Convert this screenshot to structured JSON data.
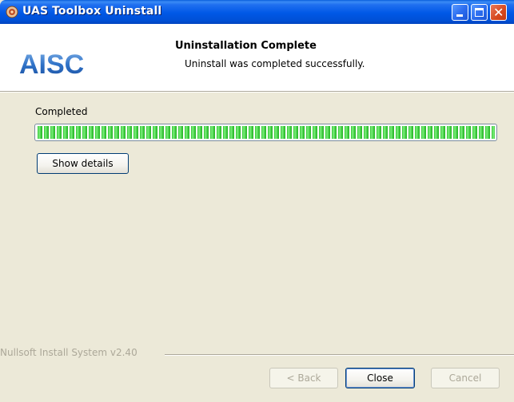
{
  "window": {
    "title": "UAS Toolbox Uninstall",
    "title_icon": "installer-icon"
  },
  "header": {
    "logo_text": "AISC",
    "title": "Uninstallation Complete",
    "subtitle": "Uninstall was completed successfully."
  },
  "body": {
    "status_label": "Completed",
    "progress": 1.0,
    "show_details_label": "Show details"
  },
  "footer": {
    "branding": "Nullsoft Install System v2.40",
    "back_label": "< Back",
    "close_label": "Close",
    "cancel_label": "Cancel"
  },
  "colors": {
    "titlebar": "#0058e6",
    "progress_fill": "#2fc02f",
    "dialog_bg": "#ece9d8"
  }
}
